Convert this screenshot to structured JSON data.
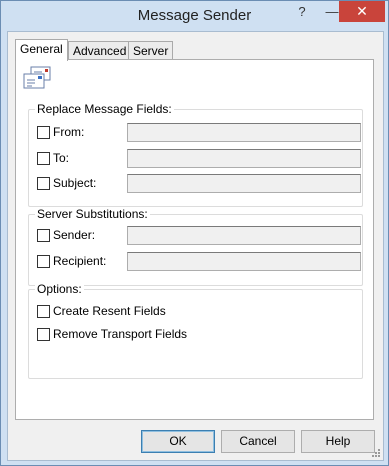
{
  "window": {
    "title": "Message Sender"
  },
  "titlebar": {
    "help": "?",
    "minimize": "—",
    "close": "✕"
  },
  "tabs": [
    {
      "label": "General"
    },
    {
      "label": "Advanced"
    },
    {
      "label": "Server"
    }
  ],
  "groups": {
    "replace": {
      "title": "Replace Message Fields:",
      "fields": [
        {
          "label": "From:",
          "value": ""
        },
        {
          "label": "To:",
          "value": ""
        },
        {
          "label": "Subject:",
          "value": ""
        }
      ]
    },
    "server": {
      "title": "Server Substitutions:",
      "fields": [
        {
          "label": "Sender:",
          "value": ""
        },
        {
          "label": "Recipient:",
          "value": ""
        }
      ]
    },
    "options": {
      "title": "Options:",
      "items": [
        {
          "label": "Create Resent Fields"
        },
        {
          "label": "Remove Transport Fields"
        }
      ]
    }
  },
  "buttons": {
    "ok": "OK",
    "cancel": "Cancel",
    "help": "Help"
  }
}
